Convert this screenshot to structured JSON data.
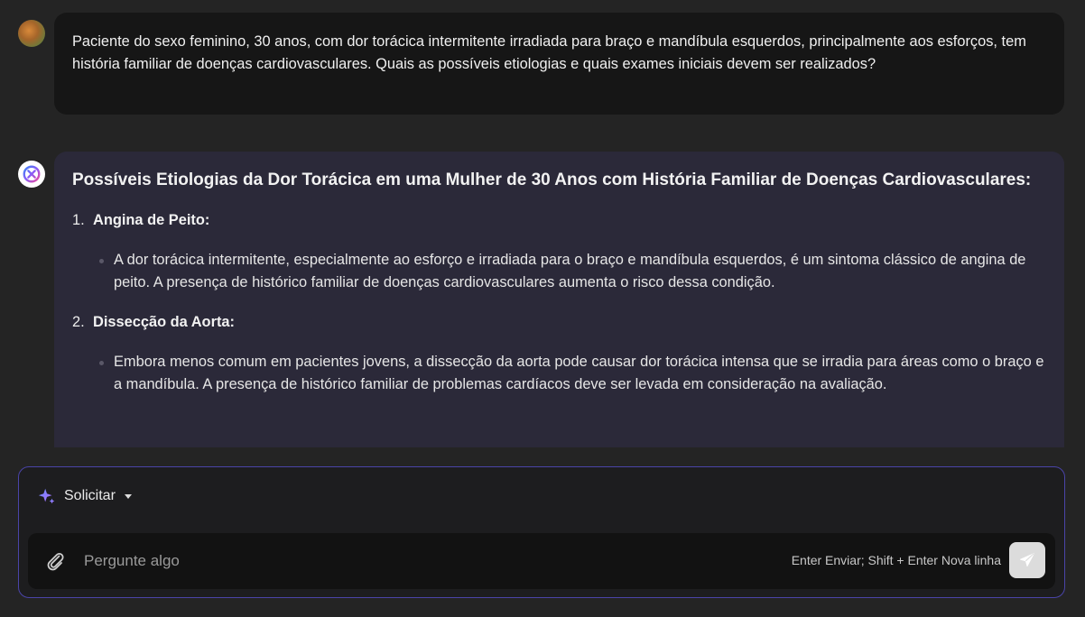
{
  "user_message": {
    "text": "Paciente do sexo feminino, 30 anos, com dor torácica intermitente irradiada para braço e mandíbula esquerdos, principalmente aos esforços, tem história familiar de doenças cardiovasculares. Quais as possíveis etiologias e quais exames iniciais devem ser realizados?"
  },
  "bot_message": {
    "title": "Possíveis Etiologias da Dor Torácica em uma Mulher de 30 Anos com História Familiar de Doenças Cardiovasculares:",
    "sections": [
      {
        "number": "1.",
        "label": "Angina de Peito:",
        "bullet": "A dor torácica intermitente, especialmente ao esforço e irradiada para o braço e mandíbula esquerdos, é um sintoma clássico de angina de peito. A presença de histórico familiar de doenças cardiovasculares aumenta o risco dessa condição."
      },
      {
        "number": "2.",
        "label": "Dissecção da Aorta:",
        "bullet": "Embora menos comum em pacientes jovens, a dissecção da aorta pode causar dor torácica intensa que se irradia para áreas como o braço e a mandíbula. A presença de histórico familiar de problemas cardíacos deve ser levada em consideração na avaliação."
      }
    ]
  },
  "composer": {
    "mode_label": "Solicitar",
    "placeholder": "Pergunte algo",
    "hint": "Enter Enviar; Shift + Enter Nova linha"
  },
  "colors": {
    "background": "#242424",
    "user_bubble": "#161616",
    "bot_bubble": "#2b2939",
    "composer_border": "#4a44a8",
    "accent": "#7b6cf6"
  },
  "icons": {
    "mode": "sparkle-icon",
    "attach": "paperclip-icon",
    "send": "send-icon",
    "dropdown": "caret-down-icon"
  }
}
